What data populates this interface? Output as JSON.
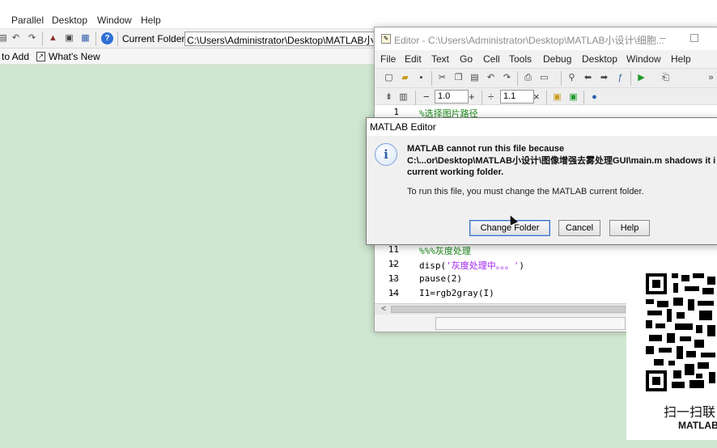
{
  "main_menu": [
    "Parallel",
    "Desktop",
    "Window",
    "Help"
  ],
  "main_toolbar": {
    "folder_label": "Current Folder:",
    "folder_path": "C:\\Users\\Administrator\\Desktop\\MATLAB小设计"
  },
  "shortcuts": {
    "add": "to Add",
    "whats_new": "What's New"
  },
  "editor": {
    "title": "Editor - C:\\Users\\Administrator\\Desktop\\MATLAB小设计\\细胞...",
    "menu": [
      "File",
      "Edit",
      "Text",
      "Go",
      "Cell",
      "Tools",
      "Debug",
      "Desktop",
      "Window",
      "Help"
    ],
    "cell_step1": "1.0",
    "cell_step2": "1.1",
    "ops": {
      "minus": "−",
      "plus": "+",
      "divide": "÷",
      "times": "×"
    },
    "lines": [
      {
        "num": "1",
        "dash": "",
        "text": "%选择图片路径",
        "color": "#1a8a1a"
      },
      {
        "num": "11",
        "dash": "",
        "text": "%%%灰度处理",
        "color": "#1a8a1a"
      },
      {
        "num": "12",
        "dash": "–",
        "text": "disp('灰度处理中。。。')",
        "color": "#000000"
      },
      {
        "num": "13",
        "dash": "–",
        "text": "pause(2)",
        "color": "#000000"
      },
      {
        "num": "14",
        "dash": "–",
        "text": "I1=rgb2gray(I)",
        "color": "#000000"
      }
    ],
    "scroll_left": "<"
  },
  "dialog": {
    "title": "MATLAB Editor",
    "message_line1": "MATLAB cannot run this file because",
    "message_line2": "C:\\...or\\Desktop\\MATLAB小设计\\图像增强去雾处理GUI\\main.m shadows it i",
    "message_line3": "current working folder.",
    "sub_message": "To run this file, you must change the MATLAB current folder.",
    "buttons": {
      "change": "Change Folder",
      "cancel": "Cancel",
      "help": "Help"
    }
  },
  "qr": {
    "caption": "扫一扫联",
    "subcaption": "MATLAB"
  },
  "colors": {
    "desktop_bg": "#cfe7d0",
    "comment": "#1a8a1a",
    "string": "#a020f0"
  }
}
